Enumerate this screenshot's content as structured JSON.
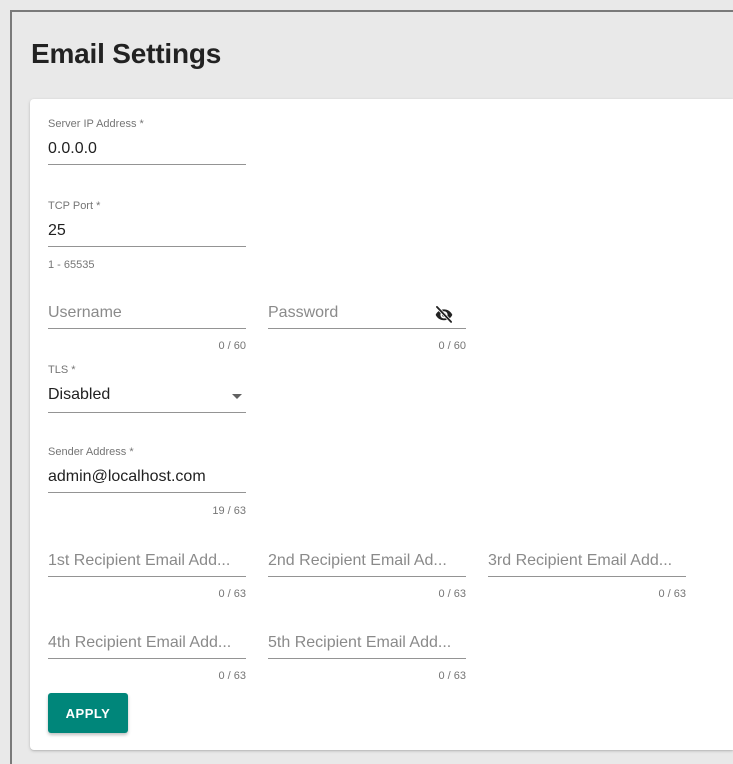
{
  "page": {
    "title": "Email Settings"
  },
  "form": {
    "server_ip": {
      "label": "Server IP Address *",
      "value": "0.0.0.0"
    },
    "tcp_port": {
      "label": "TCP Port *",
      "value": "25",
      "hint": "1 - 65535"
    },
    "username": {
      "placeholder": "Username",
      "counter": "0 / 60"
    },
    "password": {
      "placeholder": "Password",
      "counter": "0 / 60",
      "icon": "visibility-off-icon"
    },
    "tls": {
      "label": "TLS *",
      "value": "Disabled",
      "icon": "dropdown-caret-icon"
    },
    "sender": {
      "label": "Sender Address *",
      "value": "admin@localhost.com",
      "counter": "19 / 63"
    },
    "recipients": [
      {
        "placeholder": "1st Recipient Email Add...",
        "counter": "0 / 63"
      },
      {
        "placeholder": "2nd Recipient Email Ad...",
        "counter": "0 / 63"
      },
      {
        "placeholder": "3rd Recipient Email Add...",
        "counter": "0 / 63"
      },
      {
        "placeholder": "4th Recipient Email Add...",
        "counter": "0 / 63"
      },
      {
        "placeholder": "5th Recipient Email Add...",
        "counter": "0 / 63"
      }
    ],
    "apply_label": "APPLY"
  },
  "colors": {
    "accent": "#00867a",
    "background": "#e9e9e9",
    "card": "#ffffff"
  }
}
